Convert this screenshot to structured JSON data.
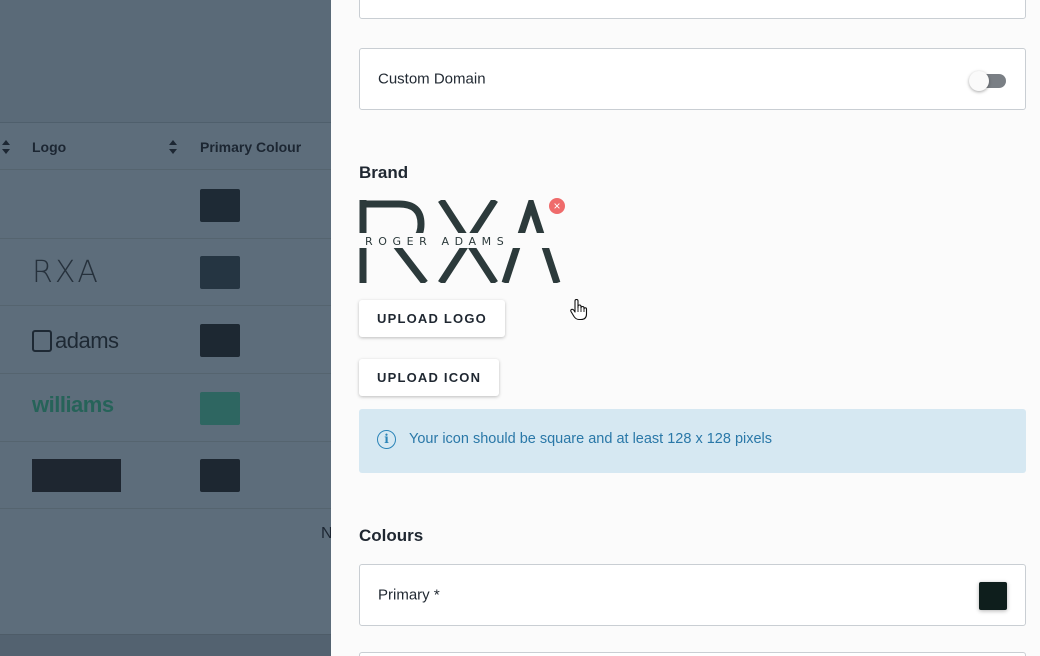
{
  "background_table": {
    "headers": [
      "Logo",
      "Primary Colour"
    ],
    "rows": [
      {
        "logo": "",
        "logo_type": "none",
        "primary_colour": "#1e2a35"
      },
      {
        "logo": "RXA",
        "logo_type": "rxa",
        "primary_colour": "#253542"
      },
      {
        "logo": "adams",
        "logo_type": "adams",
        "primary_colour": "#1d2832"
      },
      {
        "logo": "williams",
        "logo_type": "williams",
        "primary_colour": "#2e6661"
      },
      {
        "logo": "",
        "logo_type": "block",
        "primary_colour": "#1d2731"
      }
    ],
    "partial_text": "N"
  },
  "drawer": {
    "custom_domain": {
      "label": "Custom Domain",
      "enabled": false
    },
    "brand": {
      "title": "Brand",
      "logo": {
        "main": "RXA",
        "subtitle": "ROGER ADAMS",
        "color": "#2c3a3b"
      },
      "upload_logo_label": "UPLOAD LOGO",
      "upload_icon_label": "UPLOAD ICON",
      "info_icon": "info-circle-icon",
      "info_text": "Your icon should be square and at least 128 x 128 pixels"
    },
    "colours": {
      "title": "Colours",
      "primary_label": "Primary *",
      "primary_value": "#0e1e1c"
    }
  },
  "colors": {
    "overlay": "#5d6d7b",
    "info_background": "#d6e8f2",
    "info_text": "#2a78a8",
    "remove_badge": "#ef6b6b"
  }
}
